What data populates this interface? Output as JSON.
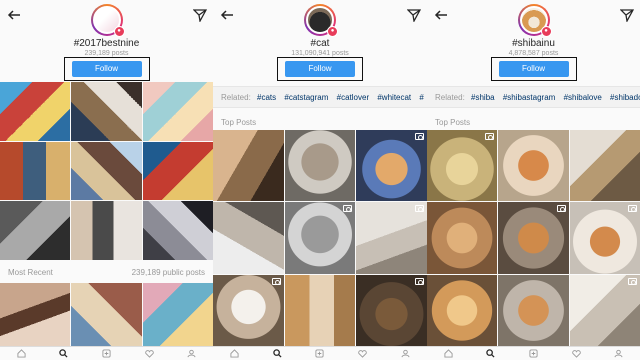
{
  "screens": [
    {
      "hashtag": "#2017bestnine",
      "posts": "239,189 posts",
      "follow": "Follow",
      "section_label": "Most Recent",
      "public_posts": "239,189 public posts"
    },
    {
      "hashtag": "#cat",
      "posts": "131,090,941 posts",
      "follow": "Follow",
      "related_label": "Related:",
      "related": [
        "#cats",
        "#catstagram",
        "#catlover",
        "#whitecat",
        "#"
      ],
      "section_label": "Top Posts"
    },
    {
      "hashtag": "#shibainu",
      "posts": "4,878,587 posts",
      "follow": "Follow",
      "related_label": "Related:",
      "related": [
        "#shiba",
        "#shibastagram",
        "#shibalove",
        "#shibado"
      ],
      "section_label": "Top Posts"
    }
  ],
  "colors": {
    "follow": "#3897f0",
    "related_tag": "#003569",
    "badge": "#e83c5a"
  },
  "icons": [
    "back-arrow-icon",
    "direct-send-icon",
    "home-icon",
    "search-icon",
    "add-icon",
    "heart-icon",
    "profile-icon",
    "video-camera-icon"
  ]
}
